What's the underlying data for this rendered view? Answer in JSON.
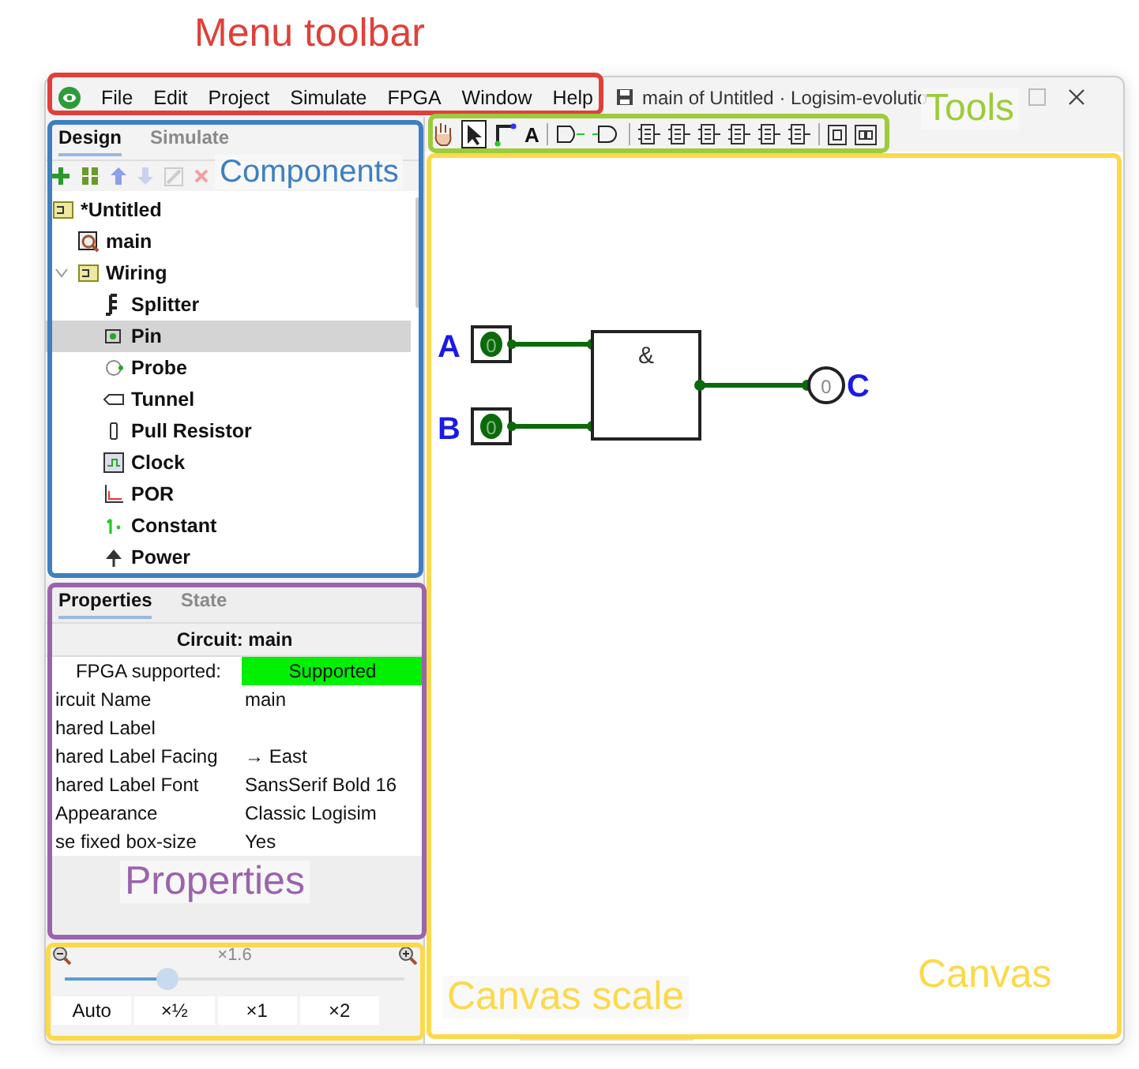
{
  "menu_bar": {
    "items": [
      "File",
      "Edit",
      "Project",
      "Simulate",
      "FPGA",
      "Window",
      "Help"
    ]
  },
  "window": {
    "title": "main of Untitled · Logisim-evolutio"
  },
  "toolbar": {
    "text_tool": "A"
  },
  "explorer": {
    "tabs": [
      {
        "label": "Design",
        "selected": true
      },
      {
        "label": "Simulate",
        "selected": false
      }
    ],
    "tree": [
      {
        "label": "*Untitled",
        "selected": false,
        "children": [
          {
            "label": "main",
            "selected": false
          },
          {
            "label": "Wiring",
            "selected": false,
            "expanded": true,
            "children": [
              {
                "label": "Splitter",
                "selected": false
              },
              {
                "label": "Pin",
                "selected": true
              },
              {
                "label": "Probe",
                "selected": false
              },
              {
                "label": "Tunnel",
                "selected": false
              },
              {
                "label": "Pull Resistor",
                "selected": false
              },
              {
                "label": "Clock",
                "selected": false
              },
              {
                "label": "POR",
                "selected": false
              },
              {
                "label": "Constant",
                "selected": false
              },
              {
                "label": "Power",
                "selected": false
              }
            ]
          }
        ]
      }
    ]
  },
  "properties": {
    "tabs": [
      {
        "label": "Properties",
        "selected": true
      },
      {
        "label": "State",
        "selected": false
      }
    ],
    "header": "Circuit: main",
    "rows": [
      {
        "name": "FPGA supported:",
        "value": "Supported",
        "kind": "status"
      },
      {
        "name": "ircuit Name",
        "value": "main",
        "kind": "text"
      },
      {
        "name": "hared Label",
        "kind": "text"
      },
      {
        "name": "hared Label Facing",
        "value": "→ East",
        "kind": "text"
      },
      {
        "name": "hared Label Font",
        "value": "SansSerif Bold 16",
        "kind": "text"
      },
      {
        "name": "Appearance",
        "value": "Classic Logisim",
        "kind": "text"
      },
      {
        "name": "se fixed box-size",
        "value": "Yes",
        "kind": "text"
      }
    ]
  },
  "zoom": {
    "label": "×1.6",
    "level": 0.3,
    "buttons": [
      "Auto",
      "×½",
      "×1",
      "×2"
    ]
  },
  "canvas": {
    "inputs": [
      {
        "label": "A",
        "value": "0"
      },
      {
        "label": "B",
        "value": "0"
      }
    ],
    "gate": "&",
    "output": {
      "label": "C",
      "value": "0"
    }
  },
  "annotations": [
    {
      "label": "Menu toolbar",
      "color": "#e0403a"
    },
    {
      "label": "Components",
      "color": "#3f7fc1"
    },
    {
      "label": "Tools",
      "color": "#9ccc3c"
    },
    {
      "label": "Properties",
      "color": "#9b63ad"
    },
    {
      "label": "Canvas scale",
      "color": "#fcd94a"
    },
    {
      "label": "Canvas",
      "color": "#fcd94a"
    }
  ]
}
